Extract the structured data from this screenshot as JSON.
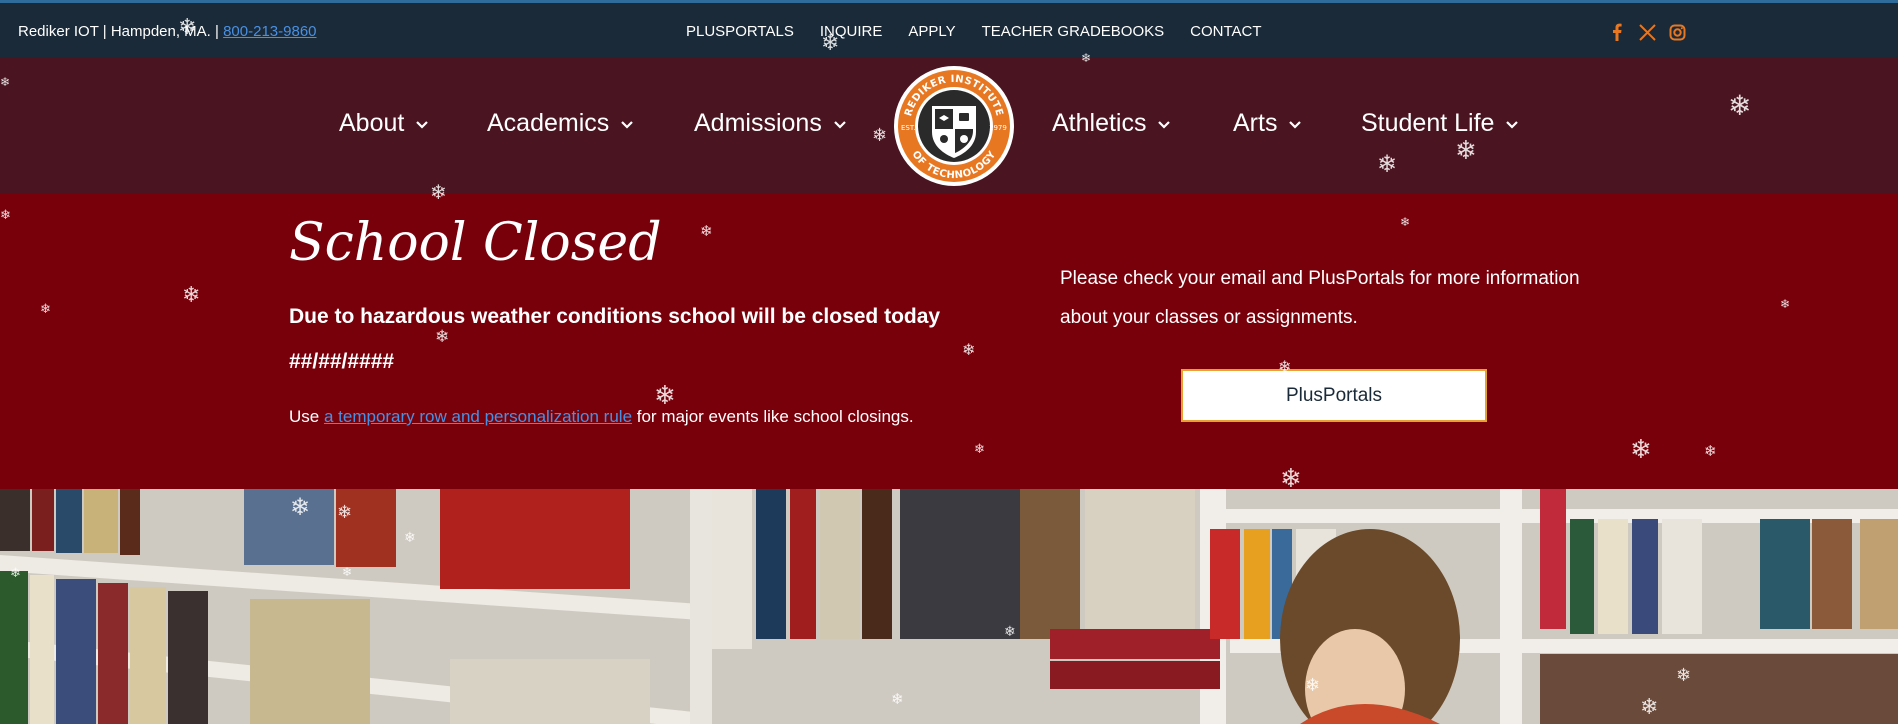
{
  "topbar": {
    "contact_prefix": "Rediker IOT | Hampden, MA. | ",
    "phone": "800-213-9860",
    "links": [
      "PLUSPORTALS",
      "INQUIRE",
      "APPLY",
      "TEACHER GRADEBOOKS",
      "CONTACT"
    ],
    "social_icons": [
      "facebook-icon",
      "x-icon",
      "instagram-icon"
    ]
  },
  "nav": {
    "items": [
      "About",
      "Academics",
      "Admissions",
      "Athletics",
      "Arts",
      "Student Life"
    ]
  },
  "logo": {
    "text_top": "REDIKER INSTITUTE",
    "text_bottom": "OF TECHNOLOGY",
    "est": "EST.",
    "year": "1979"
  },
  "banner": {
    "title": "School Closed",
    "subtitle": "Due to hazardous weather conditions school will be closed today",
    "date": "##/##/####",
    "use_prefix": "Use ",
    "use_link": "a temporary row and personalization rule",
    "use_suffix": " for major events like school closings.",
    "info": "Please check your email and PlusPortals for more information about your classes or assignments.",
    "button_label": "PlusPortals"
  },
  "colors": {
    "topbar_bg": "#1a2a38",
    "nav_bg": "#4a1520",
    "banner_bg": "#78000b",
    "accent_orange": "#e87722",
    "link_blue": "#4a90e2"
  }
}
